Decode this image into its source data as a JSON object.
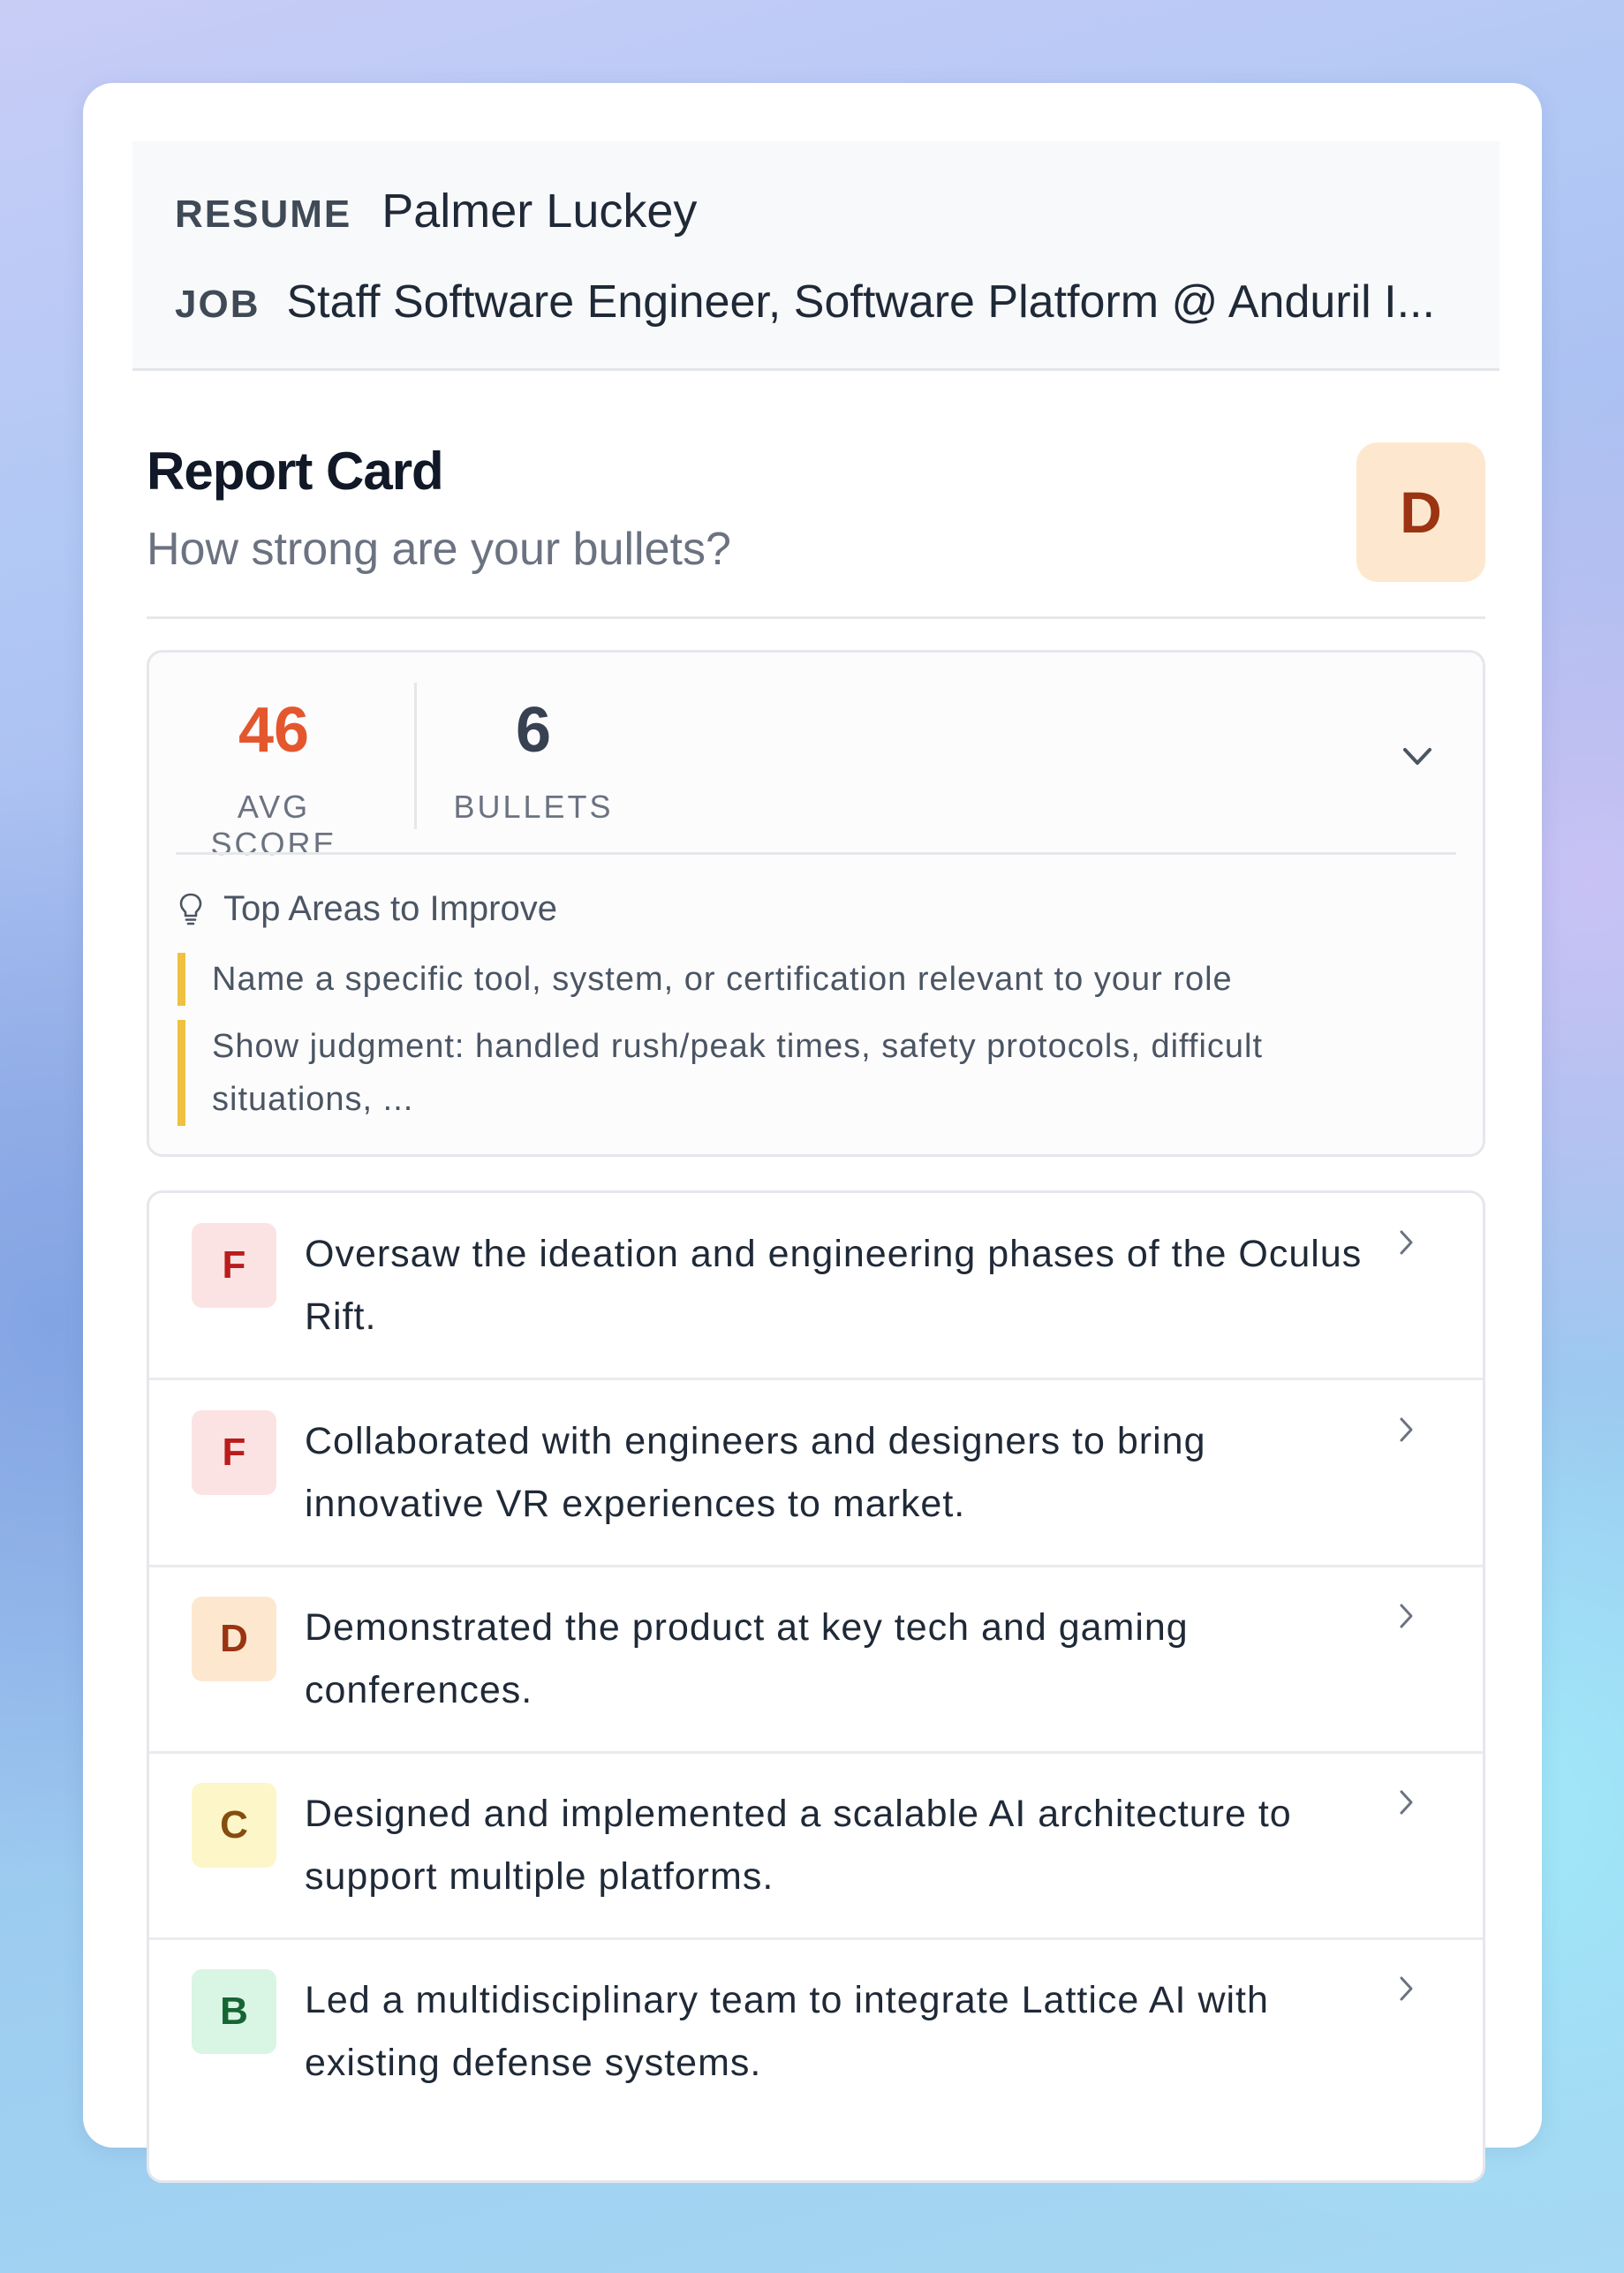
{
  "header": {
    "resume_label": "RESUME",
    "resume_value": "Palmer Luckey",
    "job_label": "JOB",
    "job_value": "Staff Software Engineer, Software Platform @ Anduril I..."
  },
  "report": {
    "title": "Report Card",
    "subtitle": "How strong are your bullets?",
    "overall_grade": "D"
  },
  "summary": {
    "avg_score": "46",
    "avg_score_label": "AVG SCORE",
    "bullets_count": "6",
    "bullets_label": "BULLETS",
    "expand_icon": "chevron-down-icon",
    "improve_title": "Top Areas to Improve",
    "improve_icon": "lightbulb-icon",
    "tips": [
      "Name a specific tool, system, or certification relevant to your role",
      "Show judgment: handled rush/peak times, safety protocols, difficult situations, ..."
    ]
  },
  "bullets": [
    {
      "grade": "F",
      "text": "Oversaw the ideation and engineering phases of the Oculus Rift.",
      "badge_bg": "#fbe3e3",
      "badge_fg": "#b91c1c"
    },
    {
      "grade": "F",
      "text": "Collaborated with engineers and designers to bring innovative VR experiences to market.",
      "badge_bg": "#fbe3e3",
      "badge_fg": "#b91c1c"
    },
    {
      "grade": "D",
      "text": "Demonstrated the product at key tech and gaming conferences.",
      "badge_bg": "#fde8cf",
      "badge_fg": "#9a3412"
    },
    {
      "grade": "C",
      "text": "Designed and implemented a scalable AI architecture to support multiple platforms.",
      "badge_bg": "#fcf6c8",
      "badge_fg": "#854d0e"
    },
    {
      "grade": "B",
      "text": "Led a multidisciplinary team to integrate Lattice AI with existing defense systems.",
      "badge_bg": "#d9f5e4",
      "badge_fg": "#166534"
    }
  ],
  "colors": {
    "accent_score": "#e4572e",
    "tip_border": "#f0c040",
    "grade_d_bg": "#fde8cf",
    "grade_d_fg": "#9a3412"
  }
}
